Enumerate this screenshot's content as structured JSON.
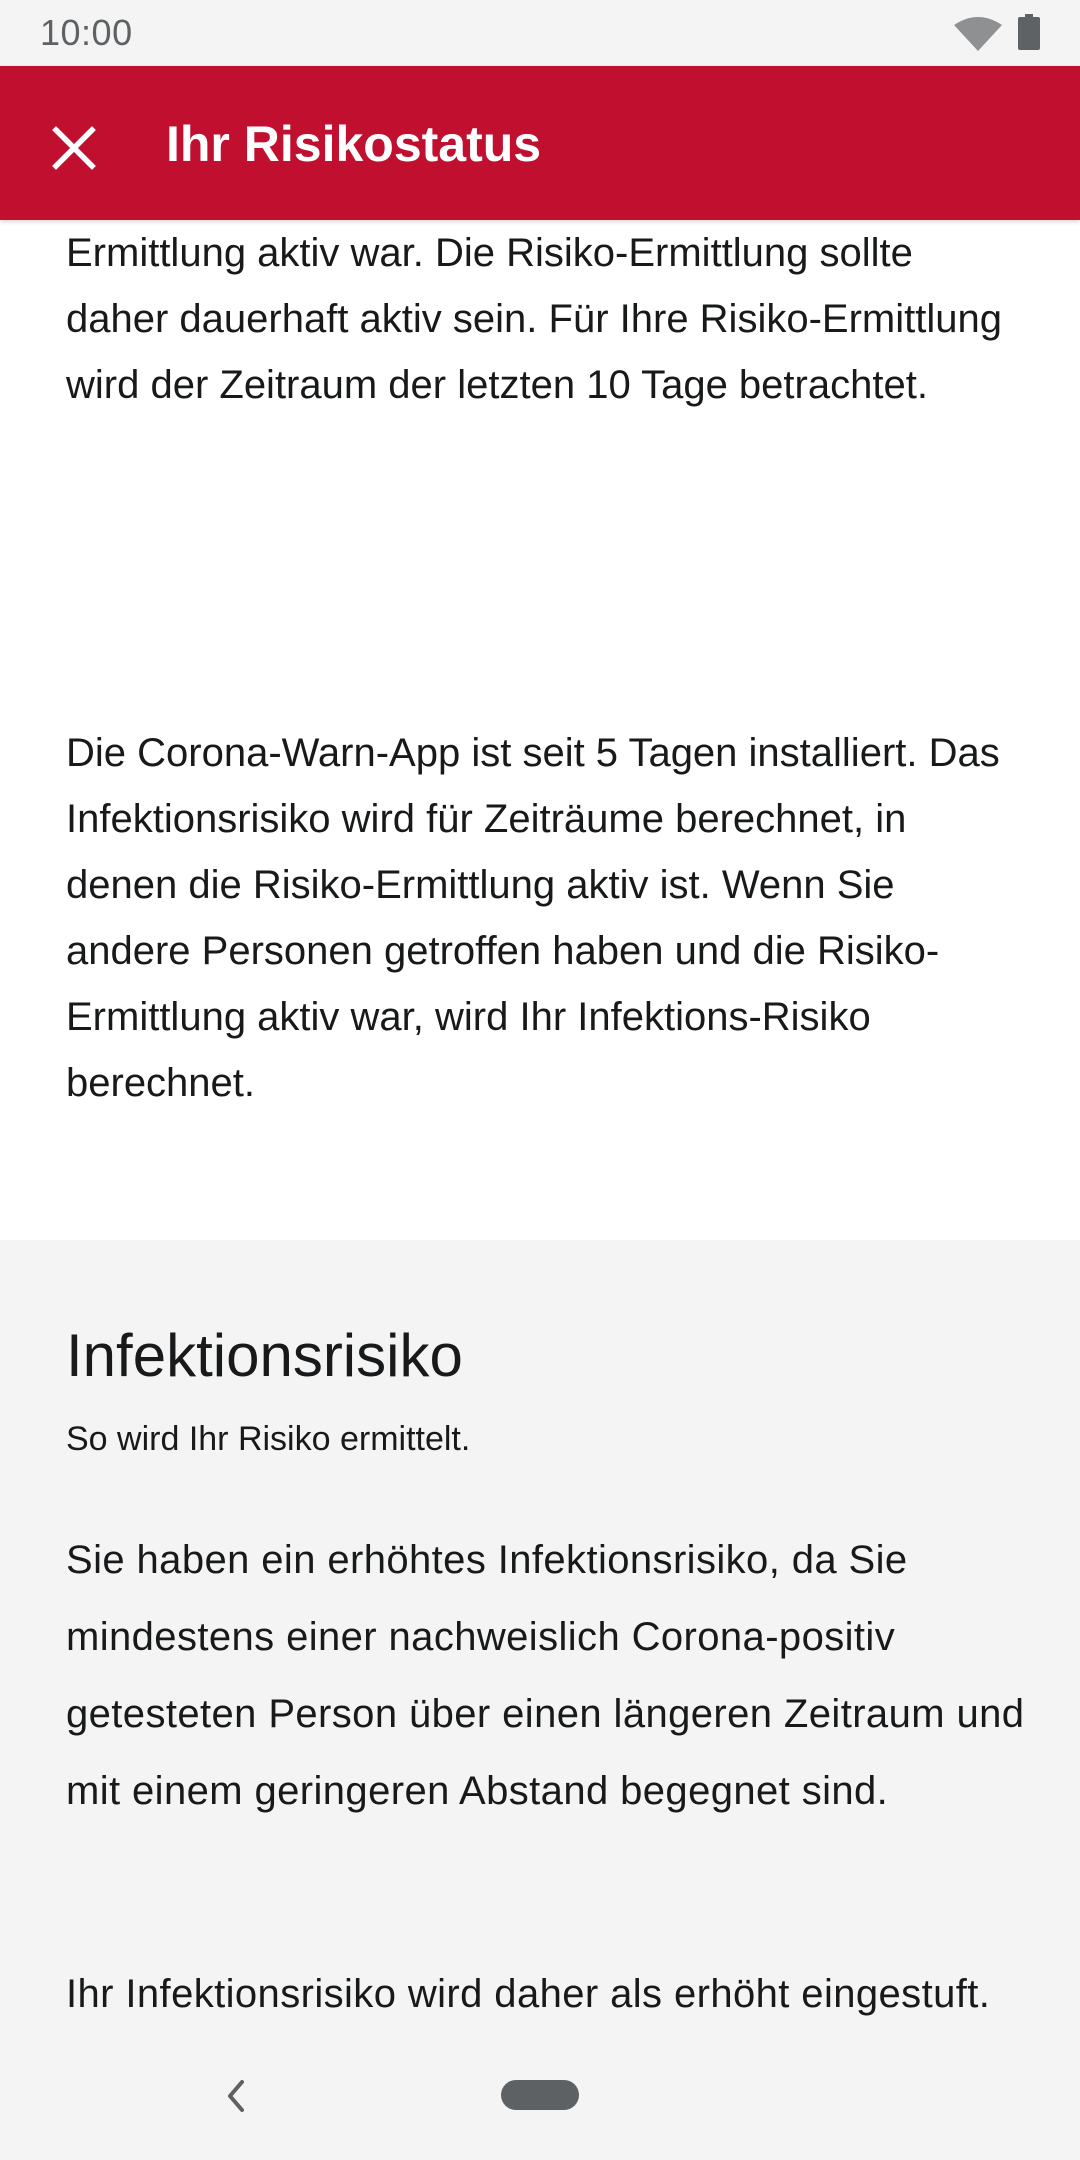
{
  "status_bar": {
    "time": "10:00",
    "icons": [
      "wifi-icon",
      "battery-icon"
    ]
  },
  "app_bar": {
    "title": "Ihr Risikostatus",
    "close_icon": "close-icon",
    "background_color": "#c1102f"
  },
  "content": {
    "intro_paragraph": "nur für die Zeiträume erfolgen, an denen die Risiko-Ermittlung aktiv war. Die Risiko-Ermittlung sollte daher dauerhaft aktiv sein. Für Ihre Risiko-Ermittlung wird der Zeitraum der letzten 10 Tage betrachtet.",
    "install_paragraph": "Die Corona-Warn-App ist seit 5 Tagen installiert. Das Infektionsrisiko wird für Zeiträume berechnet, in denen die Risiko-Ermittlung aktiv ist. Wenn Sie andere Personen getroffen haben und die Risiko-Ermittlung aktiv war, wird Ihr Infektions-Risiko berechnet."
  },
  "infection_section": {
    "title": "Infektionsrisiko",
    "subtitle": "So wird Ihr Risiko ermittelt.",
    "paragraph_1": "Sie haben ein erhöhtes Infektionsrisiko, da Sie mindestens einer nachweislich Corona-positiv getesteten Person über einen längeren Zeitraum und mit einem geringeren Abstand begegnet sind.",
    "paragraph_2": "Ihr Infektionsrisiko wird daher als erhöht eingestuft. Das Infektionsrisiko wird anhand der Daten der Risiko-Ermittlung unter Berücksichtigung von Abstand und Dauer"
  },
  "nav_bar": {
    "icons": [
      "back-icon",
      "home-pill"
    ]
  }
}
